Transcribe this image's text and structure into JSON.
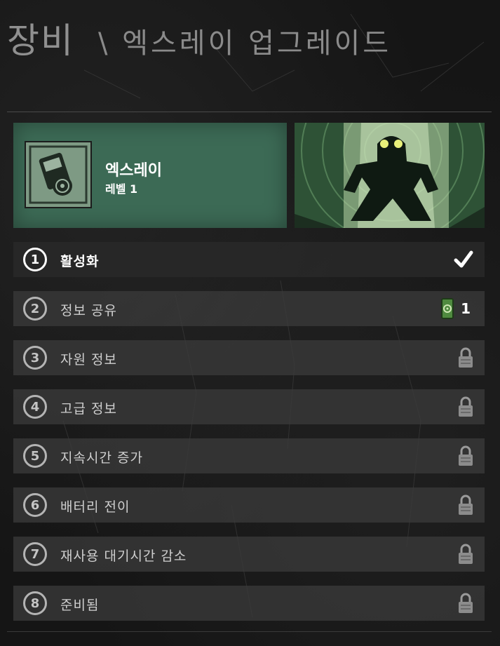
{
  "header": {
    "title": "장비",
    "subtitle": "\\ 엑스레이  업그레이드"
  },
  "gadget": {
    "name": "엑스레이",
    "level": "레벨 1",
    "icon": "xray-gadget-icon",
    "card_color": "#3c6a55"
  },
  "agent_art": {
    "icon": "agent-silhouette-art"
  },
  "upgrades": [
    {
      "number": "1",
      "label": "활성화",
      "status": "unlocked",
      "status_icon": "checkmark-icon"
    },
    {
      "number": "2",
      "label": "정보  공유",
      "status": "available",
      "status_icon": "upgrade-token-icon",
      "cost": "1"
    },
    {
      "number": "3",
      "label": "자원  정보",
      "status": "locked",
      "status_icon": "lock-icon"
    },
    {
      "number": "4",
      "label": "고급  정보",
      "status": "locked",
      "status_icon": "lock-icon"
    },
    {
      "number": "5",
      "label": "지속시간  증가",
      "status": "locked",
      "status_icon": "lock-icon"
    },
    {
      "number": "6",
      "label": "배터리  전이",
      "status": "locked",
      "status_icon": "lock-icon"
    },
    {
      "number": "7",
      "label": "재사용  대기시간  감소",
      "status": "locked",
      "status_icon": "lock-icon"
    },
    {
      "number": "8",
      "label": "준비됨",
      "status": "locked",
      "status_icon": "lock-icon"
    }
  ],
  "colors": {
    "background": "#151515",
    "row": "#3a3a3a",
    "accent_green": "#3c6a55",
    "token_green": "#4f8a3f"
  }
}
